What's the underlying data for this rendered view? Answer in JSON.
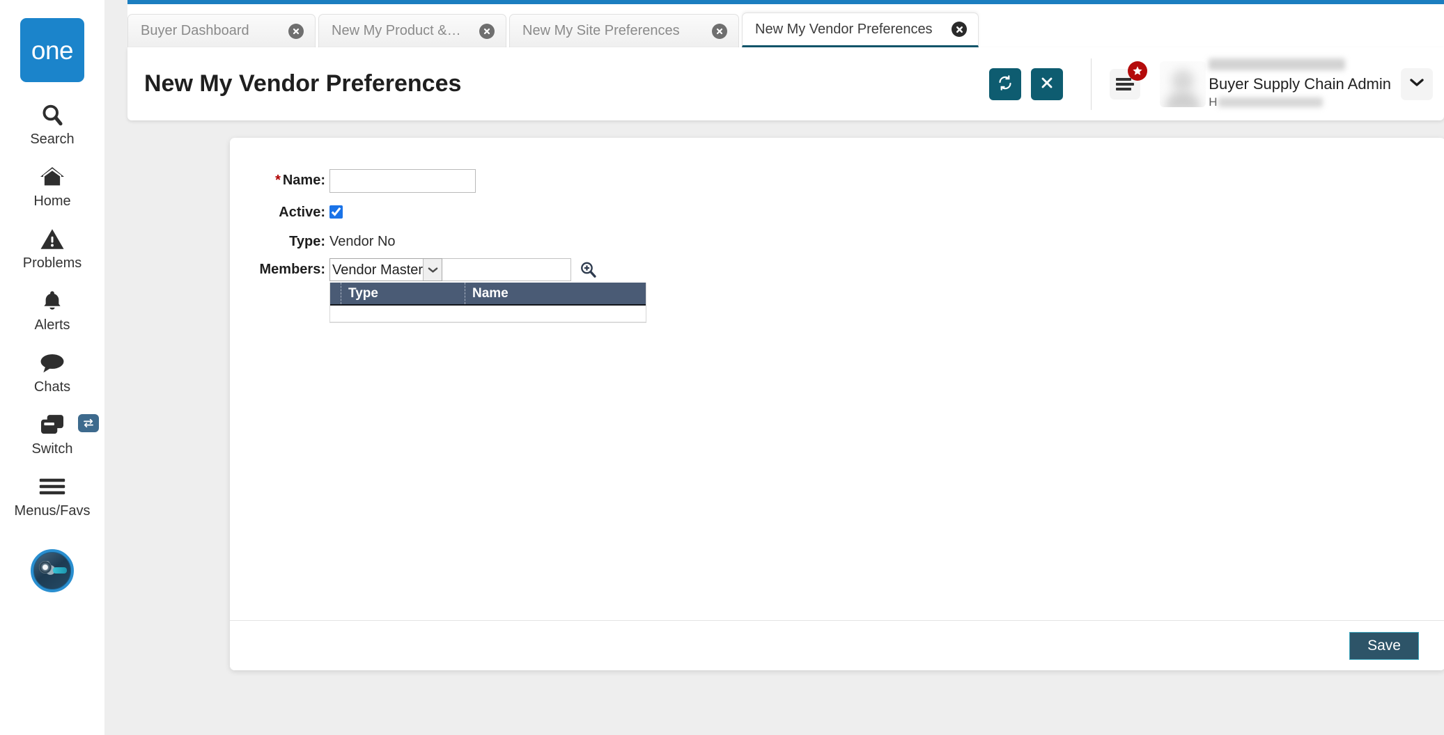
{
  "sidebar": {
    "logo_text": "one",
    "items": [
      {
        "label": "Search",
        "icon": "search-icon"
      },
      {
        "label": "Home",
        "icon": "home-icon"
      },
      {
        "label": "Problems",
        "icon": "warning-triangle-icon"
      },
      {
        "label": "Alerts",
        "icon": "bell-icon"
      },
      {
        "label": "Chats",
        "icon": "chat-bubble-icon"
      },
      {
        "label": "Switch",
        "icon": "switch-windows-icon"
      },
      {
        "label": "Menus/Favs",
        "icon": "hamburger-icon"
      }
    ]
  },
  "tabs": [
    {
      "label": "Buyer Dashboard",
      "active": false
    },
    {
      "label": "New My Product & Item Preferen...",
      "active": false
    },
    {
      "label": "New My Site Preferences",
      "active": false
    },
    {
      "label": "New My Vendor Preferences",
      "active": true
    }
  ],
  "header": {
    "title": "New My Vendor Preferences",
    "refresh_icon": "refresh-icon",
    "close_icon": "close-x-icon",
    "menu_icon": "menu-favorites-icon",
    "star_badge_icon": "star-icon",
    "caret_icon": "chevron-down-icon"
  },
  "user": {
    "name": "",
    "role": "Buyer Supply Chain Admin",
    "email_prefix": "H"
  },
  "form": {
    "name": {
      "label": "Name:",
      "required": true,
      "value": "",
      "placeholder": ""
    },
    "active": {
      "label": "Active:",
      "checked": true
    },
    "type": {
      "label": "Type:",
      "value": "Vendor No"
    },
    "members": {
      "label": "Members:",
      "selected": "Vendor Master",
      "options": [
        "Vendor Master"
      ],
      "search_value": "",
      "search_placeholder": "",
      "lookup_icon": "magnifier-plus-icon",
      "grid": {
        "columns": [
          "Type",
          "Name"
        ],
        "rows": []
      }
    }
  },
  "footer": {
    "save_label": "Save"
  },
  "colors": {
    "brand_blue": "#1b84cb",
    "topbar_blue": "#1b7ec0",
    "teal_button": "#0e5c70",
    "active_tab_underline": "#11556a",
    "grid_header": "#4a5b75",
    "save_bg": "#2d5468",
    "save_border": "#3ea6bd",
    "required_star": "#b00000",
    "star_badge": "#b40b0b",
    "checkbox": "#1a73e8"
  }
}
